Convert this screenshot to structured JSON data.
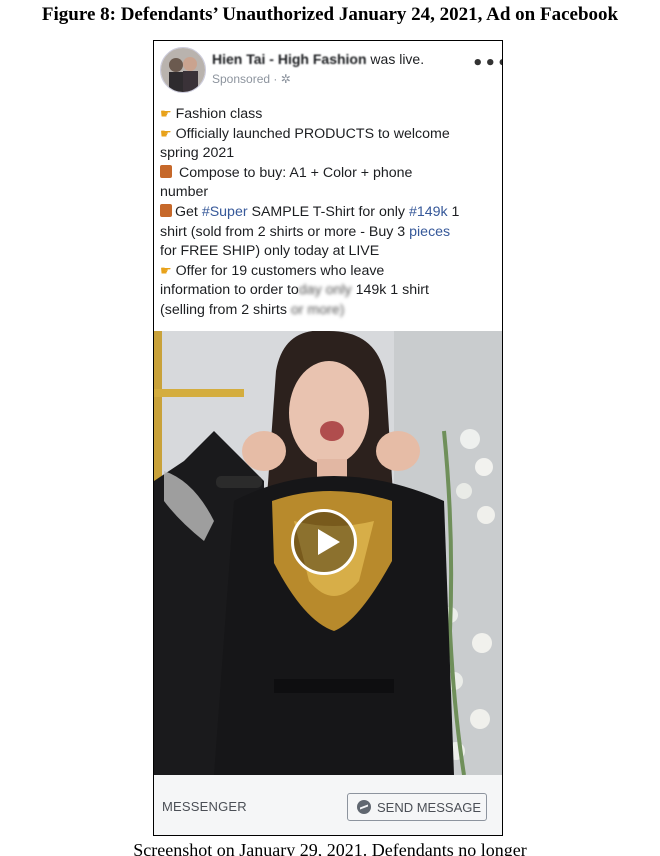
{
  "figure": {
    "title": "Figure 8: Defendants’ Unauthorized January 24, 2021, Ad on Facebook",
    "caption": "Screenshot on January 29, 2021. Defendants no longer"
  },
  "post": {
    "page_name": "Hien Tai - High Fashion",
    "live_text": "was live.",
    "sponsored": "Sponsored · ",
    "sponsored_icon": "gear-icon",
    "more_icon": "more-options-icon",
    "text_lines": {
      "l1": "Fashion class",
      "l2": "Officially launched PRODUCTS to welcome",
      "l3": "spring 2021",
      "l4": "Compose to buy: A1 + Color + phone",
      "l5": "number",
      "l6a": "Get ",
      "l6b": "#Super",
      "l6c": " SAMPLE T-Shirt for only ",
      "l6d": "#149k",
      "l6e": " 1",
      "l7a": "shirt (sold from 2 shirts or more - Buy 3 ",
      "l7b": "pieces",
      "l8": "for FREE SHIP) only today at LIVE",
      "l9": "Offer for 19 customers who leave",
      "l10a": "information to order to",
      "l10b": "day only",
      "l10c": " 149k 1 shirt",
      "l11a": "(selling from 2 shirts ",
      "l11b": "or more)"
    },
    "emoji": {
      "hand": "👉",
      "gift": "🎁"
    },
    "colors": {
      "link": "#365899",
      "footer_bg": "#f5f6f7",
      "hand": "#e8a21a"
    }
  },
  "footer": {
    "messenger_label": "MESSENGER",
    "send_button_label": "SEND MESSAGE"
  }
}
